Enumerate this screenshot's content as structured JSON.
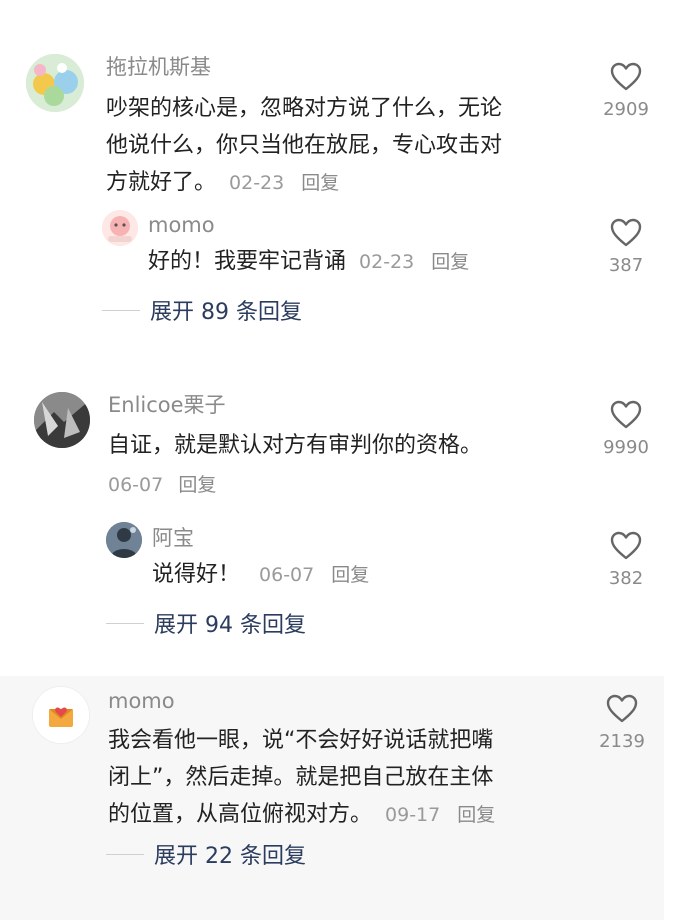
{
  "comments": [
    {
      "author": "拖拉机斯基",
      "text_lines": [
        "吵架的核心是，忽略对方说了什么，无论",
        "他说什么，你只当他在放屁，专心攻击对",
        "方就好了。"
      ],
      "date": "02-23",
      "reply_label": "回复",
      "likes": "2909",
      "replies": [
        {
          "author": "momo",
          "text": "好的！我要牢记背诵",
          "date": "02-23",
          "reply_label": "回复",
          "likes": "387"
        }
      ],
      "expand_label": "展开 89 条回复"
    },
    {
      "author": "Enlicoe栗子",
      "text_lines": [
        "自证，就是默认对方有审判你的资格。"
      ],
      "date": "06-07",
      "reply_label": "回复",
      "likes": "9990",
      "replies": [
        {
          "author": "阿宝",
          "text": "说得好！",
          "date": "06-07",
          "reply_label": "回复",
          "likes": "382"
        }
      ],
      "expand_label": "展开 94 条回复"
    },
    {
      "author": "momo",
      "text_lines": [
        "我会看他一眼，说“不会好好说话就把嘴",
        "闭上”，然后走掉。就是把自己放在主体",
        "的位置，从高位俯视对方。"
      ],
      "date": "09-17",
      "reply_label": "回复",
      "likes": "2139",
      "replies": [],
      "expand_label": "展开 22 条回复"
    }
  ],
  "colors": {
    "expand_link": "#2b3c5e",
    "meta_gray": "#9a9a9a",
    "highlight_bg": "#f7f7f7"
  },
  "icons": {
    "like": "heart-outline-icon"
  }
}
